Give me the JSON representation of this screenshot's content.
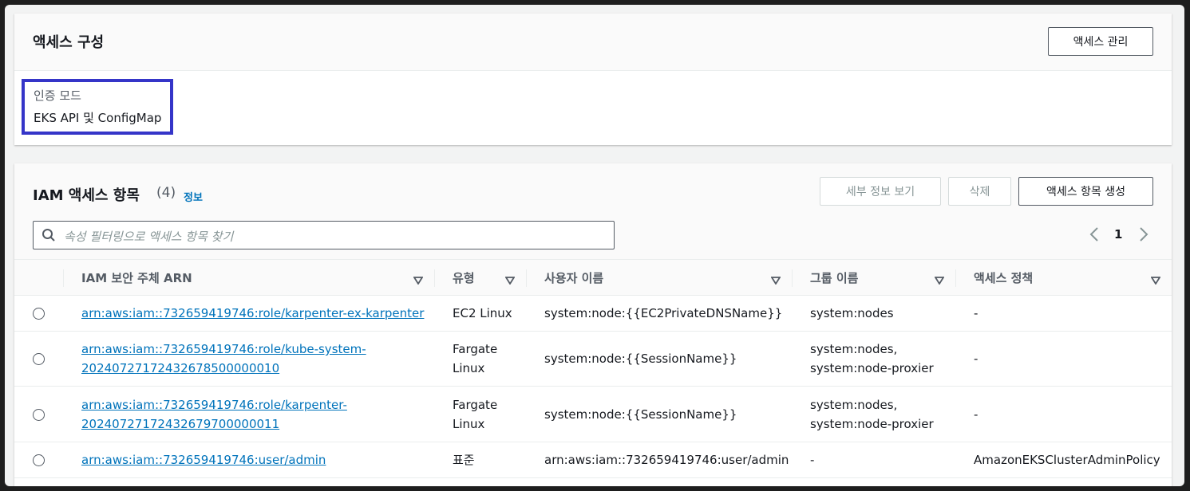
{
  "access_config": {
    "title": "액세스 구성",
    "manage_button": "액세스 관리",
    "auth_mode_label": "인증 모드",
    "auth_mode_value": "EKS API 및 ConfigMap"
  },
  "iam_entries": {
    "title": "IAM 액세스 항목",
    "count": "(4)",
    "info_link": "정보",
    "buttons": {
      "details": "세부 정보 보기",
      "delete": "삭제",
      "create": "액세스 항목 생성"
    },
    "search_placeholder": "속성 필터링으로 액세스 항목 찾기",
    "page_number": "1",
    "columns": [
      "IAM 보안 주체 ARN",
      "유형",
      "사용자 이름",
      "그룹 이름",
      "액세스 정책"
    ],
    "rows": [
      {
        "arn_line1": "arn:aws:iam::732659419746:role/karpenter-ex-karpenter",
        "arn_line2": "",
        "type_line1": "EC2 Linux",
        "type_line2": "",
        "username": "system:node:{{EC2PrivateDNSName}}",
        "group_line1": "system:nodes",
        "group_line2": "",
        "policy": "-"
      },
      {
        "arn_line1": "arn:aws:iam::732659419746:role/kube-system-",
        "arn_line2": "20240727172432678500000010",
        "type_line1": "Fargate",
        "type_line2": "Linux",
        "username": "system:node:{{SessionName}}",
        "group_line1": "system:nodes,",
        "group_line2": "system:node-proxier",
        "policy": "-"
      },
      {
        "arn_line1": "arn:aws:iam::732659419746:role/karpenter-",
        "arn_line2": "20240727172432679700000011",
        "type_line1": "Fargate",
        "type_line2": "Linux",
        "username": "system:node:{{SessionName}}",
        "group_line1": "system:nodes,",
        "group_line2": "system:node-proxier",
        "policy": "-"
      },
      {
        "arn_line1": "arn:aws:iam::732659419746:user/admin",
        "arn_line2": "",
        "type_line1": "표준",
        "type_line2": "",
        "username": "arn:aws:iam::732659419746:user/admin",
        "group_line1": "-",
        "group_line2": "",
        "policy": "AmazonEKSClusterAdminPolicy"
      }
    ]
  },
  "colors": {
    "link": "#0073bb",
    "highlight_border": "#3535c8"
  }
}
